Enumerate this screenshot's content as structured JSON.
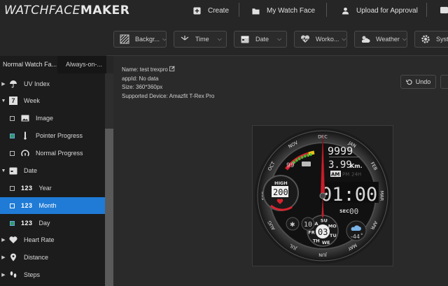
{
  "header": {
    "logo_part1": "WATCHFACE",
    "logo_part2": "MAKER",
    "create_label": "Create",
    "my_watch_face_label": "My Watch Face",
    "upload_label": "Upload for Approval"
  },
  "toolbar": {
    "background_label": "Backgr...",
    "time_label": "Time",
    "date_label": "Date",
    "workout_label": "Worko...",
    "weather_label": "Weather",
    "system_label": "Syst"
  },
  "sidebar": {
    "tab_normal": "Normal Watch Fa...",
    "tab_aod": "Always-on-...",
    "items": [
      {
        "label": "UV Index"
      },
      {
        "label": "Week"
      },
      {
        "label": "Image"
      },
      {
        "label": "Pointer Progress"
      },
      {
        "label": "Normal Progress"
      },
      {
        "label": "Date"
      },
      {
        "label": "Year"
      },
      {
        "label": "Month"
      },
      {
        "label": "Day"
      },
      {
        "label": "Heart Rate"
      },
      {
        "label": "Distance"
      },
      {
        "label": "Steps"
      }
    ],
    "num_icon": "123",
    "week_icon_text": "7"
  },
  "info": {
    "name_label": "Name:",
    "name_value": "test trexpro",
    "appid_label": "appId:",
    "appid_value": "No data",
    "size_label": "Size:",
    "size_value": "360*360px",
    "device_label": "Supported Device:",
    "device_value": "Amazfit T-Rex Pro"
  },
  "actions": {
    "undo_label": "Undo"
  },
  "watch": {
    "months": [
      "DEC",
      "JAN",
      "FEB",
      "MAR",
      "APR",
      "MAY",
      "JUN",
      "JUL",
      "AUG",
      "SEP",
      "OCT",
      "NOV"
    ],
    "steps": "9999",
    "distance": "3.99",
    "distance_unit": "Km.",
    "battery": "99",
    "am": "AM",
    "pm": "PM",
    "h24": "24H",
    "high_label": "HIGH",
    "heart": "200",
    "time": "01:00",
    "sec_label": "SEC",
    "seconds": "00",
    "day_num": "03",
    "days": [
      "SA",
      "SU",
      "MO",
      "TU",
      "WE",
      "TH",
      "FR"
    ],
    "left_num": "10",
    "temp": "-44",
    "temp_unit": "°"
  },
  "colors": {
    "accent": "#1f7bd6",
    "red": "#d9232e",
    "green": "#36c23a"
  }
}
